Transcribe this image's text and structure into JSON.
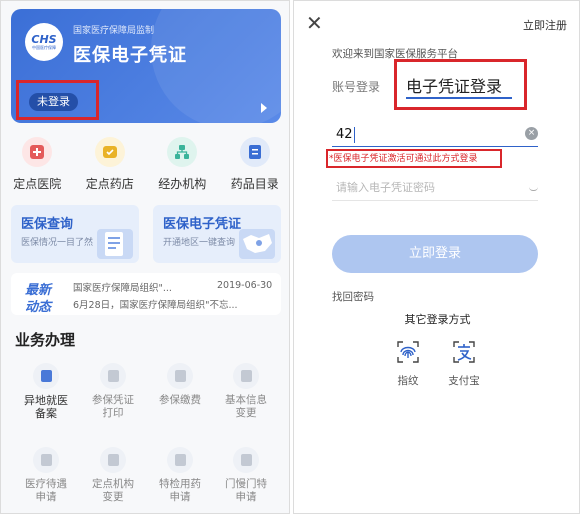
{
  "left": {
    "banner": {
      "logo_text": "CHS",
      "logo_sub": "中国医疗保障",
      "org": "国家医疗保障局监制",
      "title": "医保电子凭证",
      "login_status": "未登录"
    },
    "quick_icons": [
      {
        "label": "定点医院",
        "icon": "hospital-icon",
        "color": "#e45b5b",
        "bg": "#fde6e6"
      },
      {
        "label": "定点药店",
        "icon": "pharmacy-icon",
        "color": "#e9b227",
        "bg": "#fdf3d8"
      },
      {
        "label": "经办机构",
        "icon": "agency-icon",
        "color": "#3bb39a",
        "bg": "#dff4ee"
      },
      {
        "label": "药品目录",
        "icon": "catalog-icon",
        "color": "#3a6ed4",
        "bg": "#e1eaf9"
      }
    ],
    "cards": [
      {
        "title": "医保查询",
        "subtitle": "医保情况一目了然"
      },
      {
        "title": "医保电子凭证",
        "subtitle": "开通地区一键查询"
      }
    ],
    "news": {
      "tag_line1": "最新",
      "tag_line2": "动态",
      "line1": "国家医疗保障局组织\"...",
      "date": "2019-06-30",
      "line2": "6月28日，国家医疗保障局组织\"不忘..."
    },
    "section_title": "业务办理",
    "services": [
      {
        "label1": "异地就医",
        "label2": "备案"
      },
      {
        "label1": "参保凭证",
        "label2": "打印"
      },
      {
        "label1": "参保缴费",
        "label2": ""
      },
      {
        "label1": "基本信息",
        "label2": "变更"
      },
      {
        "label1": "医疗待遇",
        "label2": "申请"
      },
      {
        "label1": "定点机构",
        "label2": "变更"
      },
      {
        "label1": "特检用药",
        "label2": "申请"
      },
      {
        "label1": "门慢门特",
        "label2": "申请"
      }
    ]
  },
  "right": {
    "close": "✕",
    "register": "立即注册",
    "welcome": "欢迎来到国家医保服务平台",
    "tab_account": "账号登录",
    "tab_ecert": "电子凭证登录",
    "input_value": "42",
    "clear": "×",
    "hint": "*医保电子凭证激活可通过此方式登录",
    "password_placeholder": "请输入电子凭证密码",
    "login_button": "立即登录",
    "recover": "找回密码",
    "other_methods": "其它登录方式",
    "methods": [
      {
        "label": "指纹",
        "icon": "fingerprint-icon"
      },
      {
        "label": "支付宝",
        "icon": "alipay-icon"
      }
    ]
  },
  "colors": {
    "brand": "#2f62c9",
    "highlight_red": "#d9262b",
    "button_disabled": "#aec6f0"
  }
}
